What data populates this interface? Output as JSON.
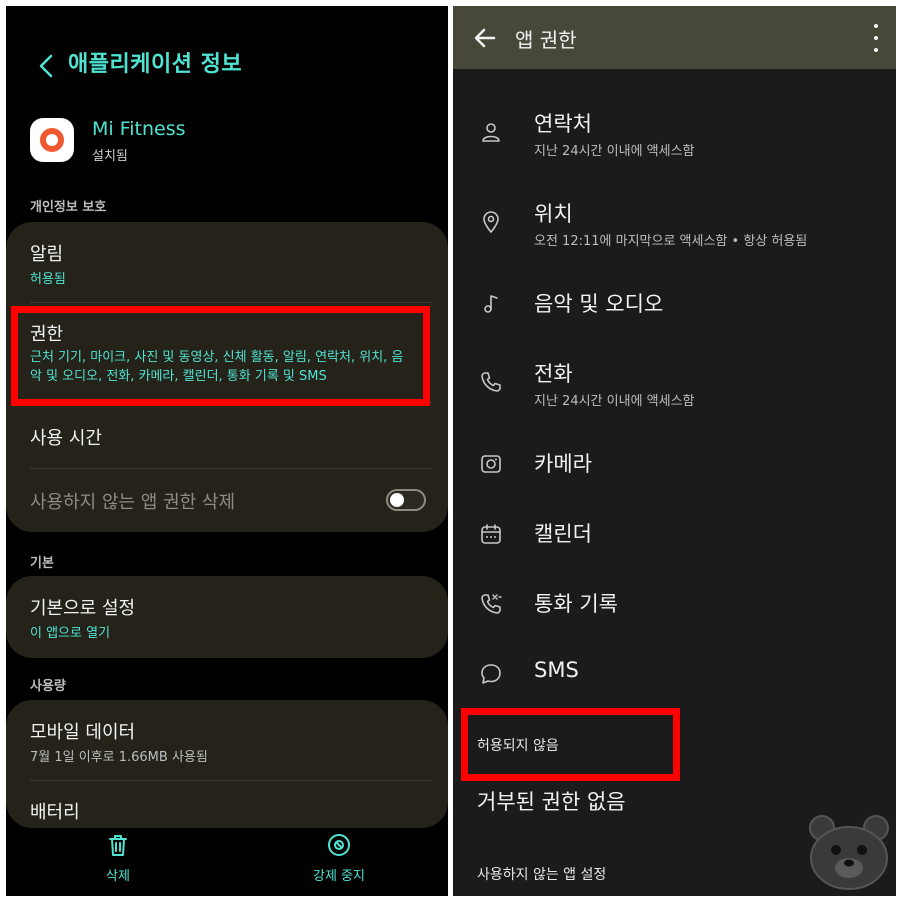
{
  "left": {
    "header": {
      "title": "애플리케이션 정보"
    },
    "app": {
      "name": "Mi Fitness",
      "status": "설치됨"
    },
    "sections": {
      "privacy": "개인정보 보호",
      "default": "기본",
      "usage": "사용량"
    },
    "privacy_card": {
      "notifications": {
        "title": "알림",
        "subtitle": "허용됨"
      },
      "permissions": {
        "title": "권한",
        "subtitle": "근처 기기, 마이크, 사진 및 동영상, 신체 활동, 알림, 연락처, 위치, 음악 및 오디오, 전화, 카메라, 캘린더, 통화 기록 및 SMS"
      },
      "screen_time": {
        "title": "사용 시간"
      },
      "remove_unused": {
        "title": "사용하지 않는 앱 권한 삭제",
        "toggle_on": false
      }
    },
    "default_card": {
      "title": "기본으로 설정",
      "subtitle": "이 앱으로 열기"
    },
    "usage_card": {
      "mobile_data": {
        "title": "모바일 데이터",
        "subtitle": "7월 1일 이후로 1.66MB 사용됨"
      },
      "battery": {
        "title": "배터리"
      }
    },
    "bottom_bar": {
      "uninstall": "삭제",
      "force_stop": "강제 중지"
    },
    "accent_color": "#4fe3d2",
    "highlight_color": "#ff0000"
  },
  "right": {
    "header": {
      "title": "앱 권한"
    },
    "permissions": [
      {
        "icon": "person-icon",
        "title": "연락처",
        "subtitle": "지난 24시간 이내에 액세스함"
      },
      {
        "icon": "location-pin-icon",
        "title": "위치",
        "subtitle": "오전 12:11에 마지막으로 액세스함 • 항상 허용됨"
      },
      {
        "icon": "music-note-icon",
        "title": "음악 및 오디오",
        "subtitle": ""
      },
      {
        "icon": "phone-icon",
        "title": "전화",
        "subtitle": "지난 24시간 이내에 액세스함"
      },
      {
        "icon": "camera-icon",
        "title": "카메라",
        "subtitle": ""
      },
      {
        "icon": "calendar-icon",
        "title": "캘린더",
        "subtitle": ""
      },
      {
        "icon": "call-log-icon",
        "title": "통화 기록",
        "subtitle": ""
      },
      {
        "icon": "chat-bubble-icon",
        "title": "SMS",
        "subtitle": ""
      }
    ],
    "not_allowed": {
      "label": "허용되지 않음",
      "empty_text": "거부된 권한 없음"
    },
    "unused_apps": {
      "label": "사용하지 않는 앱 설정"
    }
  }
}
